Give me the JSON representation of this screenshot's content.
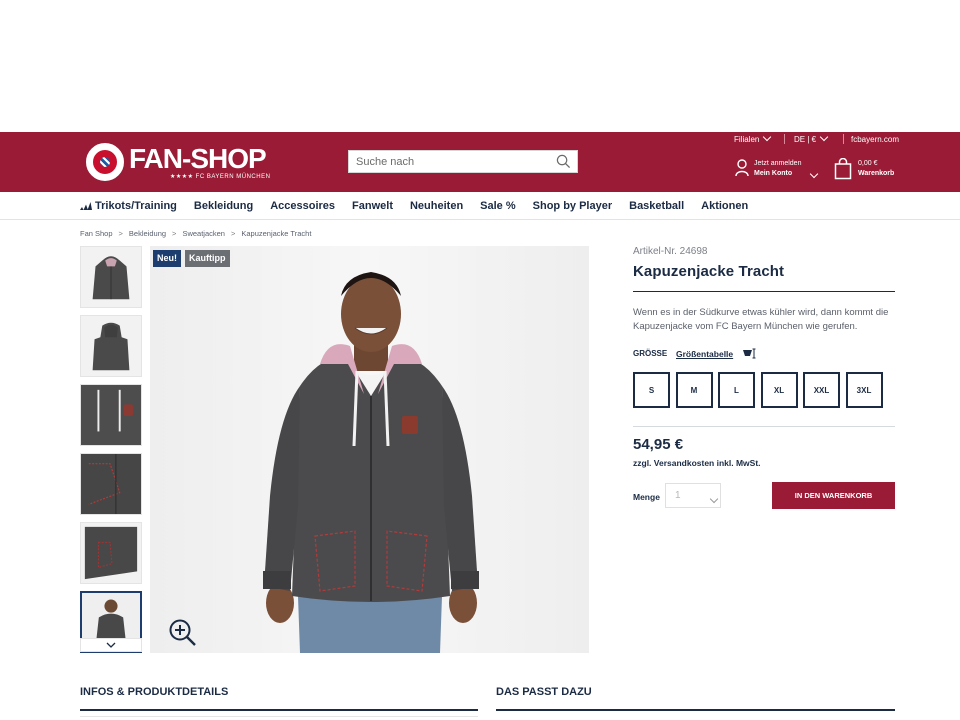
{
  "header": {
    "brand": "FAN-SHOP",
    "brand_sub": "★★★★ FC BAYERN MÜNCHEN",
    "logo_text": "FC BAYERN MÜNCHEN",
    "search_placeholder": "Suche nach",
    "top_links": {
      "stores": "Filialen",
      "locale": "DE | €",
      "site": "fcbayern.com"
    },
    "account": {
      "line1": "Jetzt anmelden",
      "line2": "Mein Konto"
    },
    "cart": {
      "line1": "0,00 €",
      "line2": "Warenkorb"
    }
  },
  "nav": {
    "items": [
      "Trikots/Training",
      "Bekleidung",
      "Accessoires",
      "Fanwelt",
      "Neuheiten",
      "Sale %",
      "Shop by Player",
      "Basketball",
      "Aktionen"
    ]
  },
  "breadcrumb": [
    "Fan Shop",
    "Bekleidung",
    "Sweatjacken",
    "Kapuzenjacke Tracht"
  ],
  "gallery": {
    "badges": {
      "new": "Neu!",
      "tip": "Kauftipp"
    },
    "thumbnail_count": 6,
    "active_thumbnail": 6
  },
  "product": {
    "article_no": "Artikel-Nr. 24698",
    "title": "Kapuzenjacke Tracht",
    "description": "Wenn es in der Südkurve etwas kühler wird, dann kommt die Kapuzenjacke vom FC Bayern München wie gerufen.",
    "size_label": "GRÖSSE",
    "size_chart_link": "Größentabelle",
    "sizes": [
      "S",
      "M",
      "L",
      "XL",
      "XXL",
      "3XL"
    ],
    "price": "54,95 €",
    "shipping_note": "zzgl. Versandkosten inkl. MwSt.",
    "quantity_label": "Menge",
    "quantity_value": "1",
    "add_to_cart": "IN DEN WARENKORB"
  },
  "sections": {
    "details_title": "INFOS & PRODUKTDETAILS",
    "related_title": "DAS PASST DAZU"
  },
  "colors": {
    "brand_red": "#9a1b35",
    "navy": "#1b2b44",
    "badge_new": "#1c3d6e",
    "badge_tip": "#6b6e73"
  }
}
